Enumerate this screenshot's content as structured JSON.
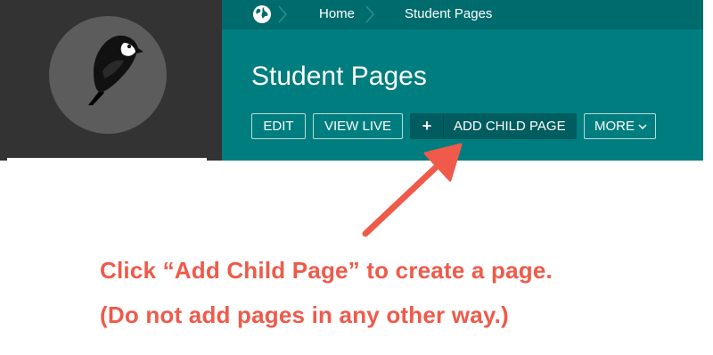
{
  "breadcrumb": {
    "items": [
      "Home",
      "Student Pages"
    ]
  },
  "page": {
    "title": "Student Pages"
  },
  "actions": {
    "edit": "EDIT",
    "view_live": "VIEW LIVE",
    "add_child_page": "ADD CHILD PAGE",
    "more": "MORE"
  },
  "icons": {
    "logo": "bird-logo-icon",
    "root": "globe-icon",
    "separator": "chevron-right-icon",
    "add": "plus-icon",
    "more": "chevron-down-icon",
    "callout": "arrow-icon"
  },
  "annotation": {
    "line1": "Click “Add Child Page” to create a page.",
    "line2": "(Do not add pages in any other way.)"
  },
  "colors": {
    "header": "#007d7e",
    "breadcrumb_bar": "#006b6d",
    "primary_button": "#005c5e",
    "sidebar": "#333333",
    "annotation": "#ef5a4a"
  }
}
